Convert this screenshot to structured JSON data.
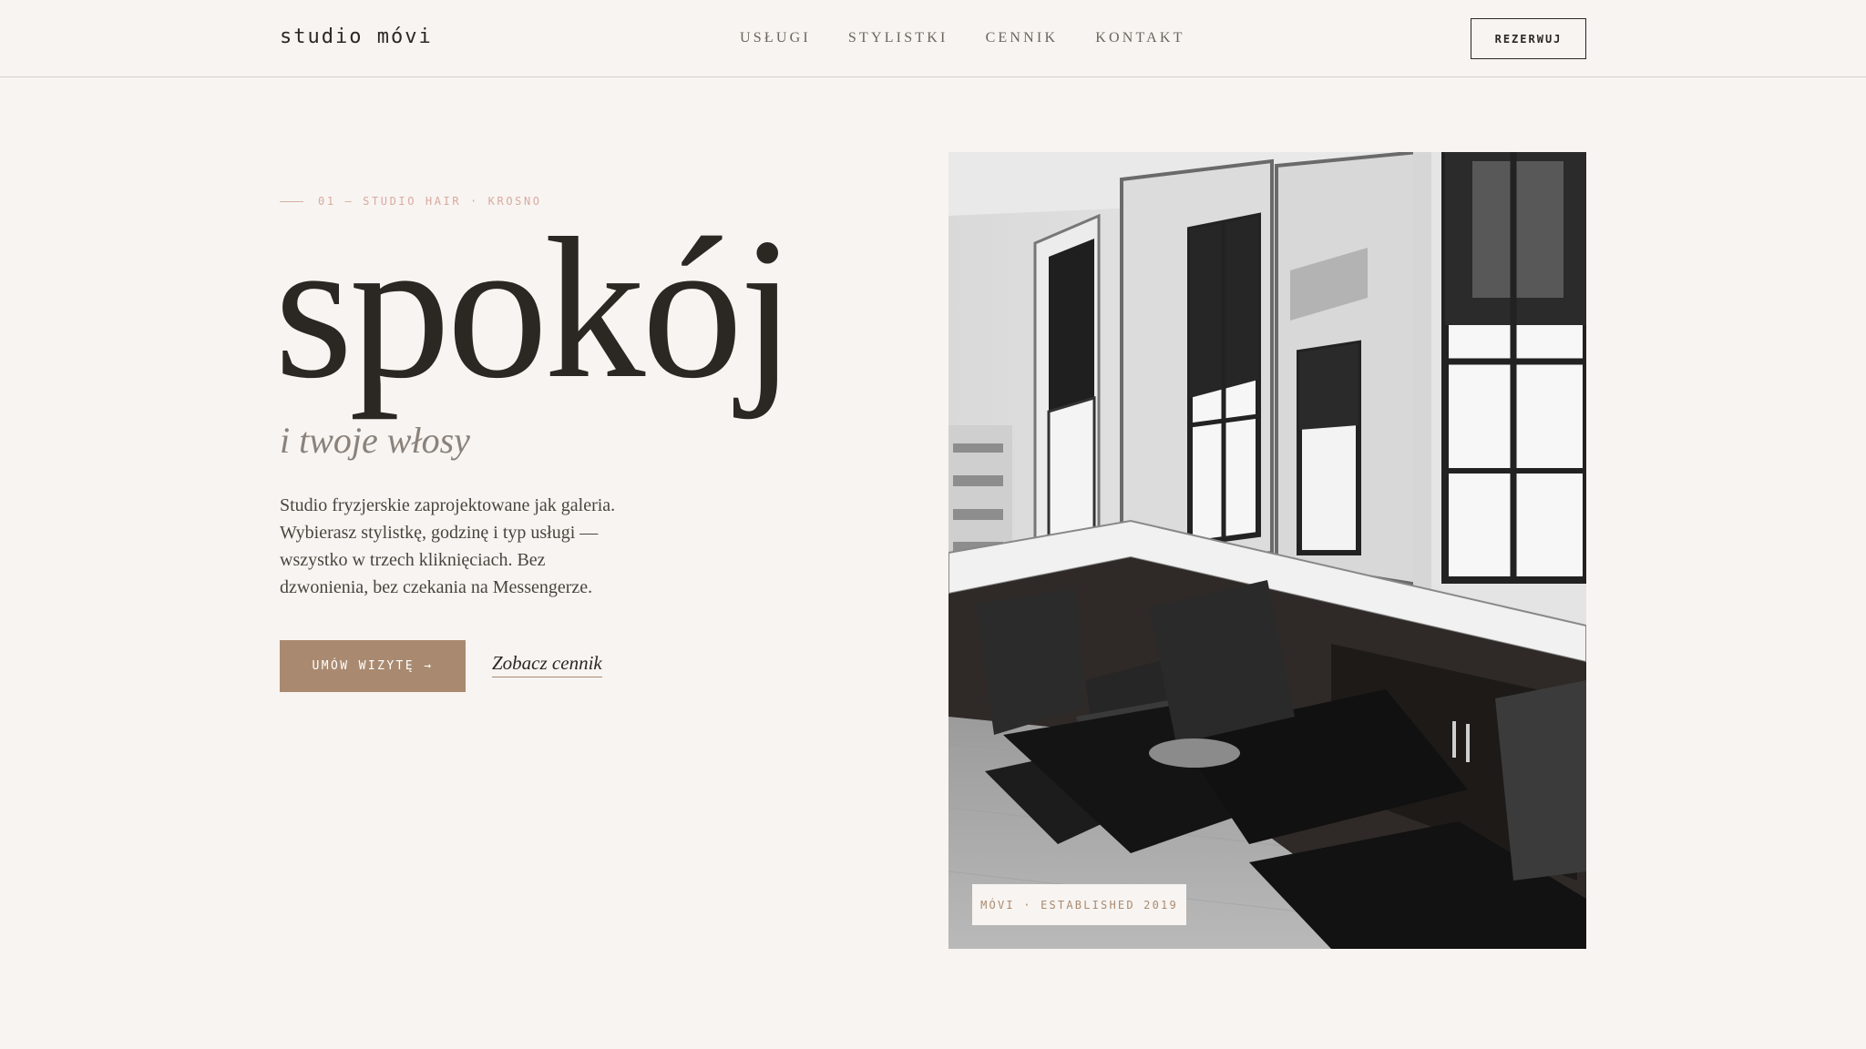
{
  "header": {
    "logo": "studio móvi",
    "nav": [
      "USŁUGI",
      "STYLISTKI",
      "CENNIK",
      "KONTAKT"
    ],
    "book_label": "REZERWUJ"
  },
  "hero": {
    "eyebrow": "01 — STUDIO HAIR · KROSNO",
    "title": "spokój",
    "subtitle": "i twoje włosy",
    "lead": "Studio fryzjerskie zaprojektowane jak galeria. Wybierasz stylistkę, godzinę i typ usługi — wszystko w trzech kliknięciach. Bez dzwonienia, bez czekania na Messengerze.",
    "cta_label": "UMÓW WIZYTĘ →",
    "price_link": "Zobacz cennik"
  },
  "photo": {
    "badge": "MÓVI · ESTABLISHED 2019"
  },
  "colors": {
    "background": "#f8f4f1",
    "accent": "#a98a70",
    "text": "#2b2722",
    "eyebrow": "#d8aaa0"
  }
}
